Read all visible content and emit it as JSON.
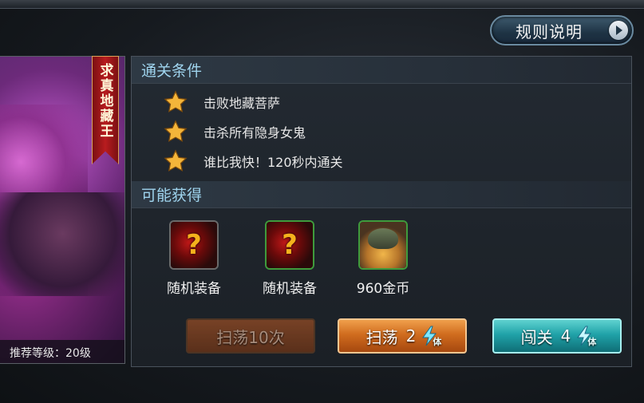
{
  "header": {
    "rules_label": "规则说明"
  },
  "stage": {
    "name": "求真地藏王",
    "recommended_level": "推荐等级：20级",
    "stars": 3
  },
  "conditions": {
    "title": "通关条件",
    "items": [
      {
        "text": "击败地藏菩萨"
      },
      {
        "text": "击杀所有隐身女鬼"
      },
      {
        "text": "谁比我快！120秒内通关"
      }
    ]
  },
  "rewards": {
    "title": "可能获得",
    "items": [
      {
        "label": "随机装备",
        "icon": "random-equipment-icon"
      },
      {
        "label": "随机装备",
        "icon": "random-equipment-icon"
      },
      {
        "label": "960金币",
        "icon": "gold-coins-icon"
      }
    ]
  },
  "actions": {
    "sweep10_label": "扫荡10次",
    "sweep_label": "扫荡",
    "sweep_cost": "2",
    "challenge_label": "闯关",
    "challenge_cost": "4",
    "energy_unit": "体"
  },
  "colors": {
    "section_title": "#9fd4ee",
    "sweep_button": "#d06c1e",
    "challenge_button": "#20a2a8",
    "star": "#f4b53a",
    "banner": "#b81c1f"
  }
}
